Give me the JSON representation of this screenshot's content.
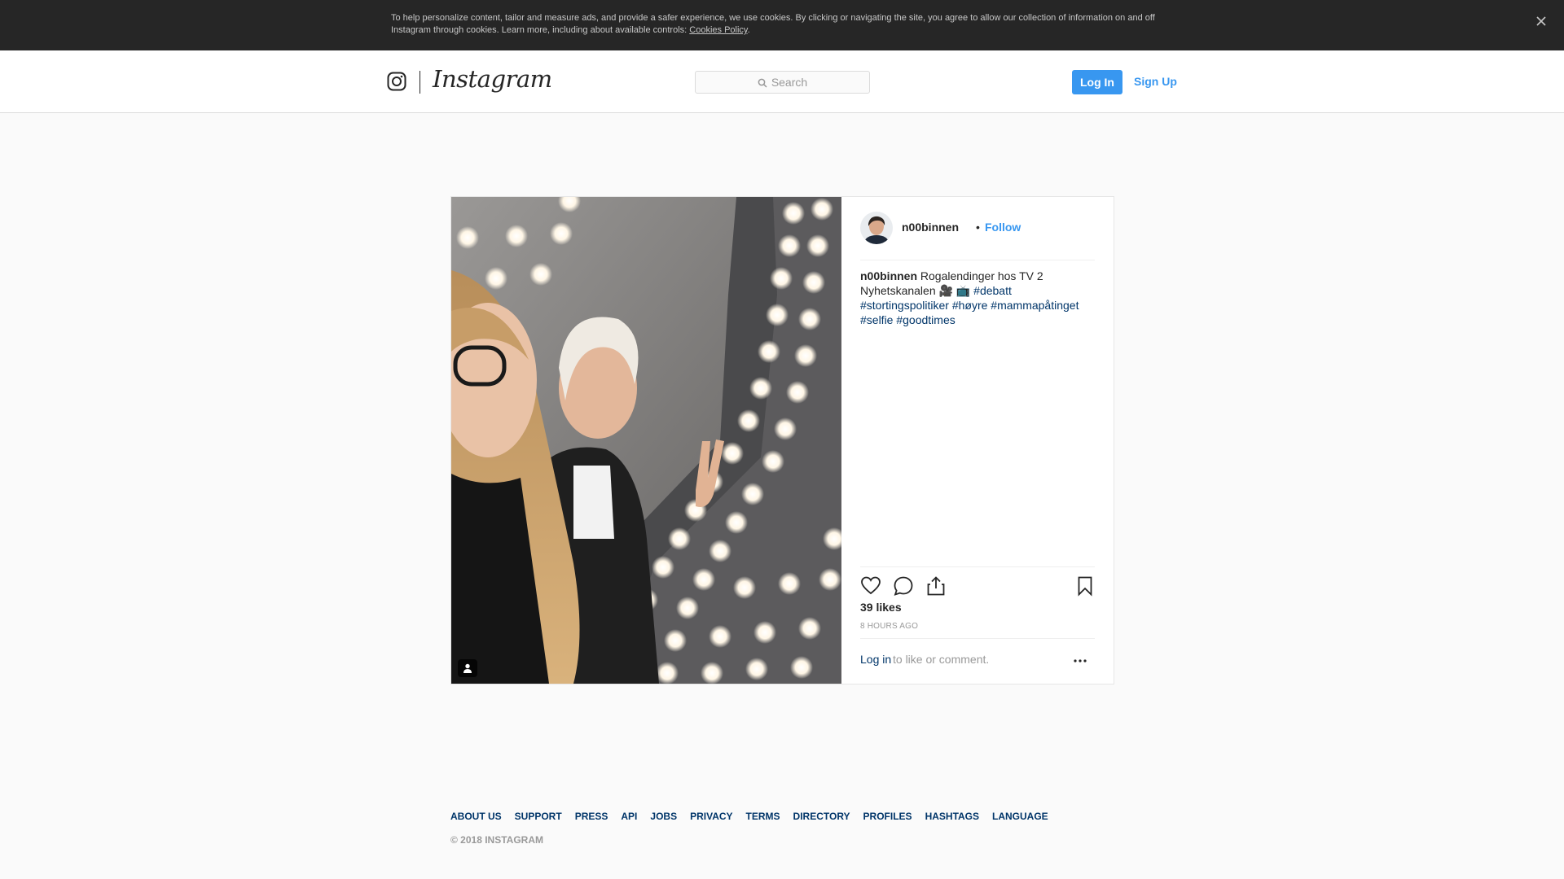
{
  "cookie_banner": {
    "text": "To help personalize content, tailor and measure ads, and provide a safer experience, we use cookies. By clicking or navigating the site, you agree to allow our collection of information on and off Instagram through cookies. Learn more, including about available controls: ",
    "link": "Cookies Policy",
    "suffix": "."
  },
  "header": {
    "brand": "Instagram",
    "search_placeholder": "Search",
    "login_label": "Log In",
    "signup_label": "Sign Up"
  },
  "post": {
    "username": "n00binnen",
    "separator": "•",
    "follow_label": "Follow",
    "caption_user": "n00binnen",
    "caption_text": "Rogalendinger hos TV 2 Nyhetskanalen 🎥 📺",
    "hashtags": [
      "#debatt",
      "#stortingspolitiker",
      "#høyre",
      "#mammapåtinget",
      "#selfie",
      "#goodtimes"
    ],
    "likes": "39 likes",
    "time": "8 HOURS AGO",
    "login_link": "Log in",
    "login_rest": "to like or comment."
  },
  "footer": {
    "links": [
      "ABOUT US",
      "SUPPORT",
      "PRESS",
      "API",
      "JOBS",
      "PRIVACY",
      "TERMS",
      "DIRECTORY",
      "PROFILES",
      "HASHTAGS",
      "LANGUAGE"
    ],
    "copyright": "© 2018 INSTAGRAM"
  },
  "colors": {
    "accent": "#3897f0",
    "link_dark": "#003569",
    "banner_bg": "#262626"
  },
  "icons": [
    "close-icon",
    "instagram-glyph-icon",
    "search-icon",
    "heart-icon",
    "comment-icon",
    "share-icon",
    "bookmark-icon",
    "more-icon",
    "user-tag-icon"
  ]
}
